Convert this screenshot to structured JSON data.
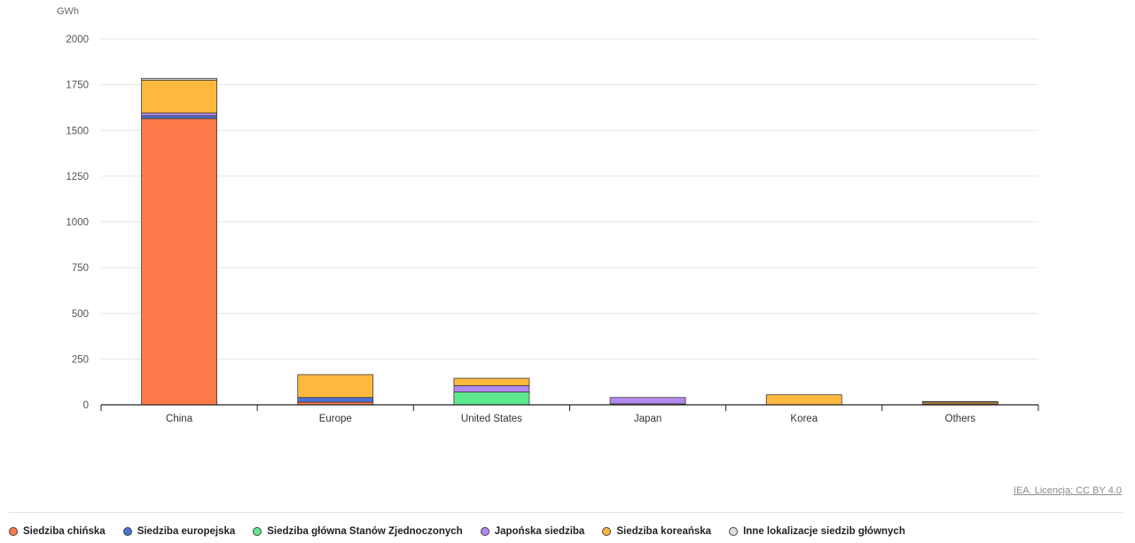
{
  "chart_data": {
    "type": "bar",
    "stacked": true,
    "unit_label": "GWh",
    "title": "",
    "xlabel": "",
    "ylabel": "GWh",
    "ylim": [
      0,
      2000
    ],
    "yticks": [
      0,
      250,
      500,
      750,
      1000,
      1250,
      1500,
      1750,
      2000
    ],
    "grid": true,
    "legend_position": "bottom",
    "categories": [
      "China",
      "Europe",
      "United States",
      "Japan",
      "Korea",
      "Others"
    ],
    "series": [
      {
        "name": "Siedziba chińska",
        "color": "#ff7a4a",
        "values": [
          1565,
          15,
          0,
          5,
          0,
          5
        ]
      },
      {
        "name": "Siedziba europejska",
        "color": "#4a73d6",
        "values": [
          15,
          25,
          0,
          0,
          0,
          0
        ]
      },
      {
        "name": "Siedziba główna Stanów Zjednoczonych",
        "color": "#5ee88d",
        "values": [
          0,
          0,
          70,
          0,
          0,
          0
        ]
      },
      {
        "name": "Japońska siedziba",
        "color": "#b388f0",
        "values": [
          15,
          0,
          35,
          35,
          0,
          0
        ]
      },
      {
        "name": "Siedziba koreańska",
        "color": "#ffb83f",
        "values": [
          180,
          125,
          40,
          0,
          55,
          10
        ]
      },
      {
        "name": "Inne lokalizacje siedzib głównych",
        "color": "#dedede",
        "values": [
          10,
          0,
          0,
          0,
          0,
          3
        ]
      }
    ]
  },
  "source": {
    "text": "IEA. Licencja: CC BY 4.0"
  }
}
